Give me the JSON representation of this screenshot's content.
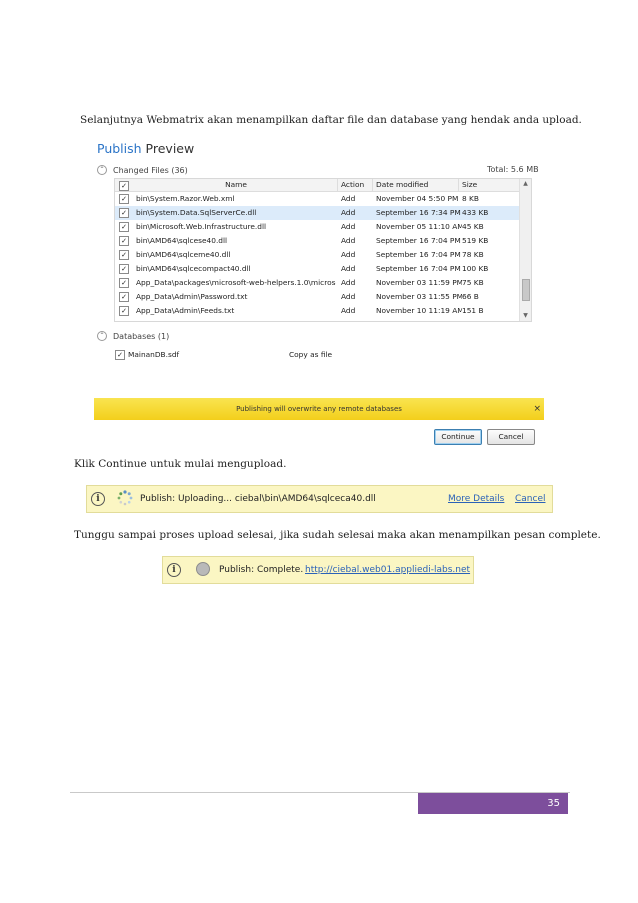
{
  "text": {
    "intro": "Selanjutnya Webmatrix akan menampilkan daftar file dan database yang hendak anda upload.",
    "continue_instruction": "Klik Continue untuk mulai mengupload.",
    "wait_instruction": "Tunggu sampai proses upload selesai, jika sudah selesai maka akan menampilkan pesan complete."
  },
  "dialog": {
    "title_part1": "Publish",
    "title_part2": "Preview",
    "changed_files_label": "Changed Files (36)",
    "total_label": "Total: 5.6 MB",
    "columns": {
      "name": "Name",
      "action": "Action",
      "date": "Date modified",
      "size": "Size"
    },
    "files": [
      {
        "name": "bin\\System.Razor.Web.xml",
        "action": "Add",
        "date": "November 04 5:50 PM",
        "size": "8 KB"
      },
      {
        "name": "bin\\System.Data.SqlServerCe.dll",
        "action": "Add",
        "date": "September 16 7:34 PM",
        "size": "433 KB"
      },
      {
        "name": "bin\\Microsoft.Web.Infrastructure.dll",
        "action": "Add",
        "date": "November 05 11:10 AM",
        "size": "45 KB"
      },
      {
        "name": "bin\\AMD64\\sqlcese40.dll",
        "action": "Add",
        "date": "September 16 7:04 PM",
        "size": "519 KB"
      },
      {
        "name": "bin\\AMD64\\sqlceme40.dll",
        "action": "Add",
        "date": "September 16 7:04 PM",
        "size": "78 KB"
      },
      {
        "name": "bin\\AMD64\\sqlcecompact40.dll",
        "action": "Add",
        "date": "September 16 7:04 PM",
        "size": "100 KB"
      },
      {
        "name": "App_Data\\packages\\microsoft-web-helpers.1.0\\microsoft-",
        "action": "Add",
        "date": "November 03 11:59 PM",
        "size": "75 KB"
      },
      {
        "name": "App_Data\\Admin\\Password.txt",
        "action": "Add",
        "date": "November 03 11:55 PM",
        "size": "66 B"
      },
      {
        "name": "App_Data\\Admin\\Feeds.txt",
        "action": "Add",
        "date": "November 10 11:19 AM",
        "size": "151 B"
      }
    ],
    "selected_row": 1,
    "databases_label": "Databases (1)",
    "database": {
      "name": "MainanDB.sdf",
      "mode": "Copy as file"
    },
    "warning": "Publishing will overwrite any remote databases",
    "close_glyph": "×",
    "continue_label": "Continue",
    "cancel_label": "Cancel",
    "check_glyph": "✓",
    "collapse_glyph": "⌃"
  },
  "uploading": {
    "message": "Publish: Uploading... ciebal\\bin\\AMD64\\sqlceca40.dll",
    "more_details": "More Details",
    "cancel": "Cancel"
  },
  "complete": {
    "message": "Publish: Complete.",
    "link": "http://ciebal.web01.appliedi-labs.net"
  },
  "footer": {
    "page_number": "35"
  },
  "colors": {
    "accent_blue": "#2b74c7",
    "warning_yellow": "#f7dc2c",
    "status_bg": "#fbf6c3",
    "footer_purple": "#7d4e9c"
  }
}
